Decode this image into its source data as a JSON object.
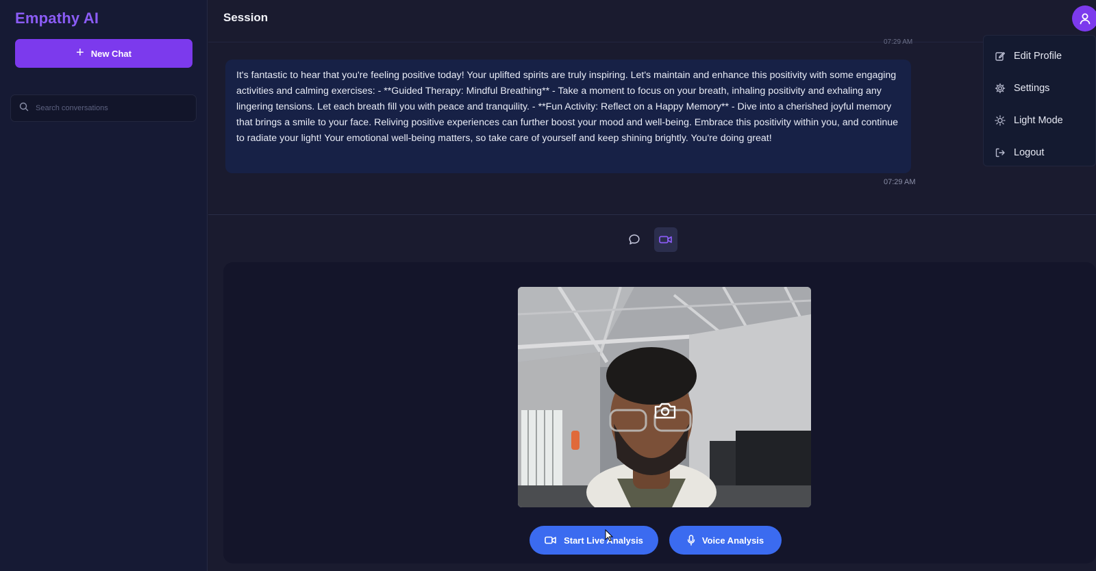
{
  "app": {
    "brand": "Empathy AI"
  },
  "sidebar": {
    "new_chat_label": "New Chat",
    "search_placeholder": "Search conversations"
  },
  "header": {
    "title": "Session"
  },
  "chat": {
    "previous_timestamp": "07:29 AM",
    "message": "It's fantastic to hear that you're feeling positive today! Your uplifted spirits are truly inspiring. Let's maintain and enhance this positivity with some engaging activities and calming exercises: - **Guided Therapy: Mindful Breathing** - Take a moment to focus on your breath, inhaling positivity and exhaling any lingering tensions. Let each breath fill you with peace and tranquility. - **Fun Activity: Reflect on a Happy Memory** - Dive into a cherished joyful memory that brings a smile to your face. Reliving positive experiences can further boost your mood and well-being. Embrace this positivity within you, and continue to radiate your light! Your emotional well-being matters, so take care of yourself and keep shining brightly. You're doing great!",
    "timestamp": "07:29 AM"
  },
  "mode_toggle": {
    "active": "video",
    "icons": [
      "chat-bubble-icon",
      "video-camera-icon"
    ]
  },
  "video_panel": {
    "start_live_label": "Start Live Analysis",
    "voice_label": "Voice Analysis"
  },
  "profile_menu": {
    "items": [
      {
        "label": "Edit Profile",
        "icon": "edit-icon"
      },
      {
        "label": "Settings",
        "icon": "gear-icon"
      },
      {
        "label": "Light Mode",
        "icon": "sun-icon"
      },
      {
        "label": "Logout",
        "icon": "logout-icon"
      }
    ]
  },
  "colors": {
    "accent_purple": "#7c3aed",
    "action_blue": "#3b6bf0",
    "bubble_bg": "#172146",
    "sidebar_bg": "#161a34"
  }
}
